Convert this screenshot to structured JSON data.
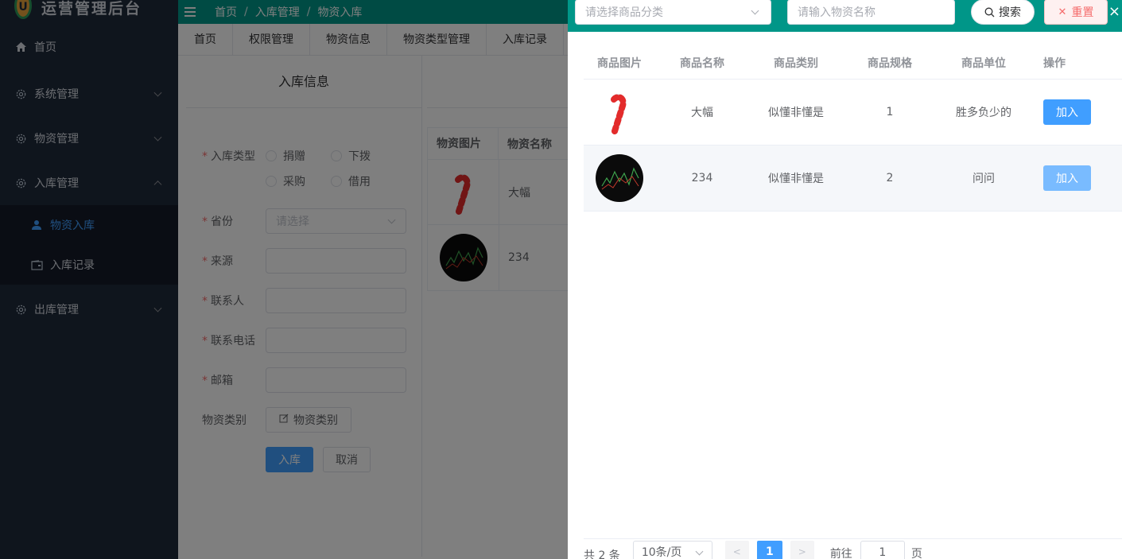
{
  "sidebar": {
    "logo_text": "运营管理后台",
    "logo_letter": "U",
    "items": [
      {
        "label": "首页"
      },
      {
        "label": "系统管理"
      },
      {
        "label": "物资管理"
      },
      {
        "label": "入库管理"
      },
      {
        "label": "出库管理"
      }
    ],
    "submenu": [
      {
        "label": "物资入库"
      },
      {
        "label": "入库记录"
      }
    ]
  },
  "topbar": {
    "breadcrumb": [
      "首页",
      "入库管理",
      "物资入库"
    ],
    "separator": "/"
  },
  "tabs": [
    "首页",
    "权限管理",
    "物资信息",
    "物资类型管理",
    "入库记录"
  ],
  "form": {
    "title": "入库信息",
    "type_label": "入库类型",
    "type_options": [
      "捐赠",
      "下拨",
      "采购",
      "借用"
    ],
    "province_label": "省份",
    "province_placeholder": "请选择",
    "source_label": "来源",
    "contact_label": "联系人",
    "phone_label": "联系电话",
    "email_label": "邮箱",
    "category_label": "物资类别",
    "category_button": "物资类别",
    "submit": "入库",
    "cancel": "取消"
  },
  "mini_table": {
    "headers": [
      "物资图片",
      "物资名称"
    ],
    "rows": [
      {
        "name": "大幅"
      },
      {
        "name": "234"
      }
    ]
  },
  "drawer": {
    "category_placeholder": "请选择商品分类",
    "name_placeholder": "请输入物资名称",
    "search_label": "搜索",
    "reset_label": "重置",
    "close": "×",
    "headers": [
      "商品图片",
      "商品名称",
      "商品类别",
      "商品规格",
      "商品单位",
      "操作"
    ],
    "rows": [
      {
        "name": "大幅",
        "category": "似懂非懂是",
        "spec": "1",
        "unit": "胜多负少的",
        "action": "加入",
        "image": "candy-cane"
      },
      {
        "name": "234",
        "category": "似懂非懂是",
        "spec": "2",
        "unit": "问问",
        "action": "加入",
        "image": "dark-chart"
      }
    ],
    "pagination": {
      "total_text": "共 2 条",
      "page_size": "10条/页",
      "current_page": "1",
      "goto_label": "前往",
      "goto_value": "1",
      "page_unit": "页"
    }
  },
  "colors": {
    "accent": "#009688",
    "primary": "#409eff",
    "sidebar_bg": "#1f2a3b",
    "danger": "#f56c6c"
  }
}
